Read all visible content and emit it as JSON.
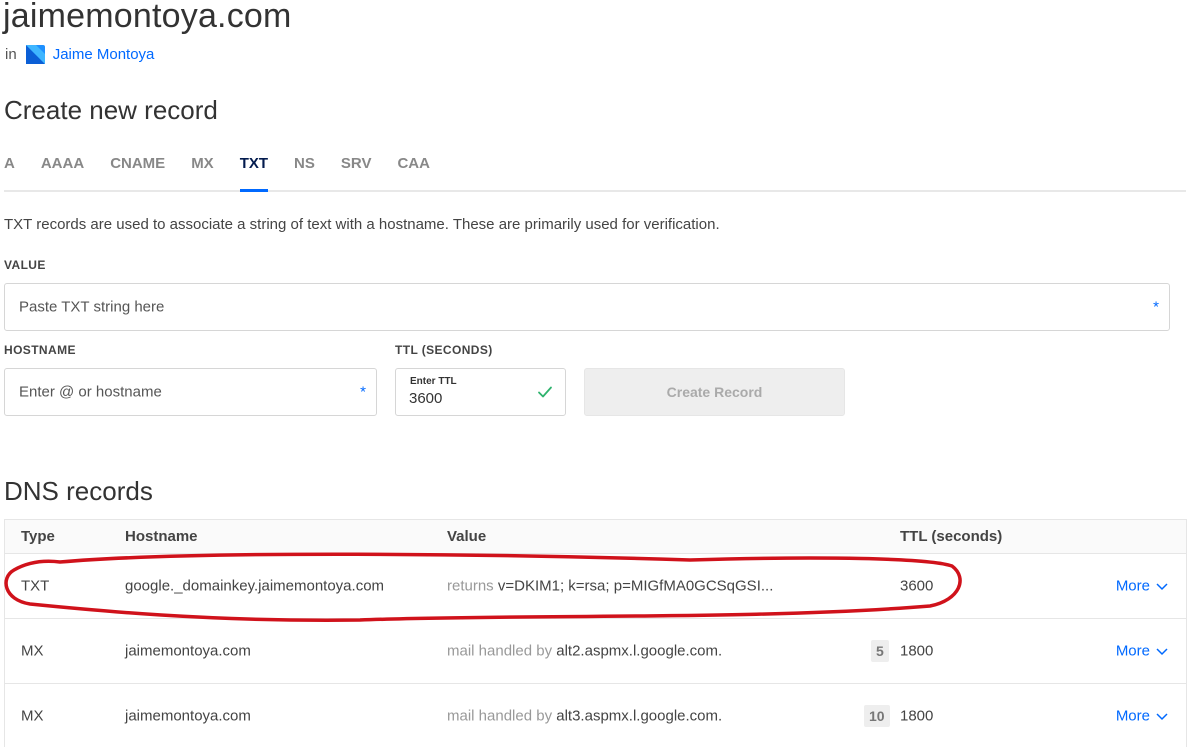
{
  "domain": {
    "name": "jaimemontoya.com",
    "in_label": "in",
    "project_name": "Jaime Montoya"
  },
  "create_record": {
    "title": "Create new record",
    "tabs": [
      {
        "label": "A",
        "active": false
      },
      {
        "label": "AAAA",
        "active": false
      },
      {
        "label": "CNAME",
        "active": false
      },
      {
        "label": "MX",
        "active": false
      },
      {
        "label": "TXT",
        "active": true
      },
      {
        "label": "NS",
        "active": false
      },
      {
        "label": "SRV",
        "active": false
      },
      {
        "label": "CAA",
        "active": false
      }
    ],
    "description": "TXT records are used to associate a string of text with a hostname. These are primarily used for verification.",
    "value_label": "VALUE",
    "value_placeholder": "Paste TXT string here",
    "hostname_label": "HOSTNAME",
    "hostname_placeholder": "Enter @ or hostname",
    "ttl_label": "TTL (SECONDS)",
    "ttl_small_label": "Enter TTL",
    "ttl_value": "3600",
    "required_marker": "*",
    "create_button_label": "Create Record"
  },
  "dns_records": {
    "title": "DNS records",
    "columns": [
      "Type",
      "Hostname",
      "Value",
      "TTL (seconds)"
    ],
    "rows": [
      {
        "type": "TXT",
        "hostname": "google._domainkey.jaimemontoya.com",
        "value_prefix": "returns",
        "value": "v=DKIM1; k=rsa; p=MIGfMA0GCSqGSI...",
        "priority": "",
        "ttl": "3600",
        "more": "More"
      },
      {
        "type": "MX",
        "hostname": "jaimemontoya.com",
        "value_prefix": "mail handled by",
        "value": "alt2.aspmx.l.google.com.",
        "priority": "5",
        "ttl": "1800",
        "more": "More"
      },
      {
        "type": "MX",
        "hostname": "jaimemontoya.com",
        "value_prefix": "mail handled by",
        "value": "alt3.aspmx.l.google.com.",
        "priority": "10",
        "ttl": "1800",
        "more": "More"
      }
    ]
  },
  "colors": {
    "accent": "#0069ff",
    "highlight_annotation": "#d0121b"
  }
}
